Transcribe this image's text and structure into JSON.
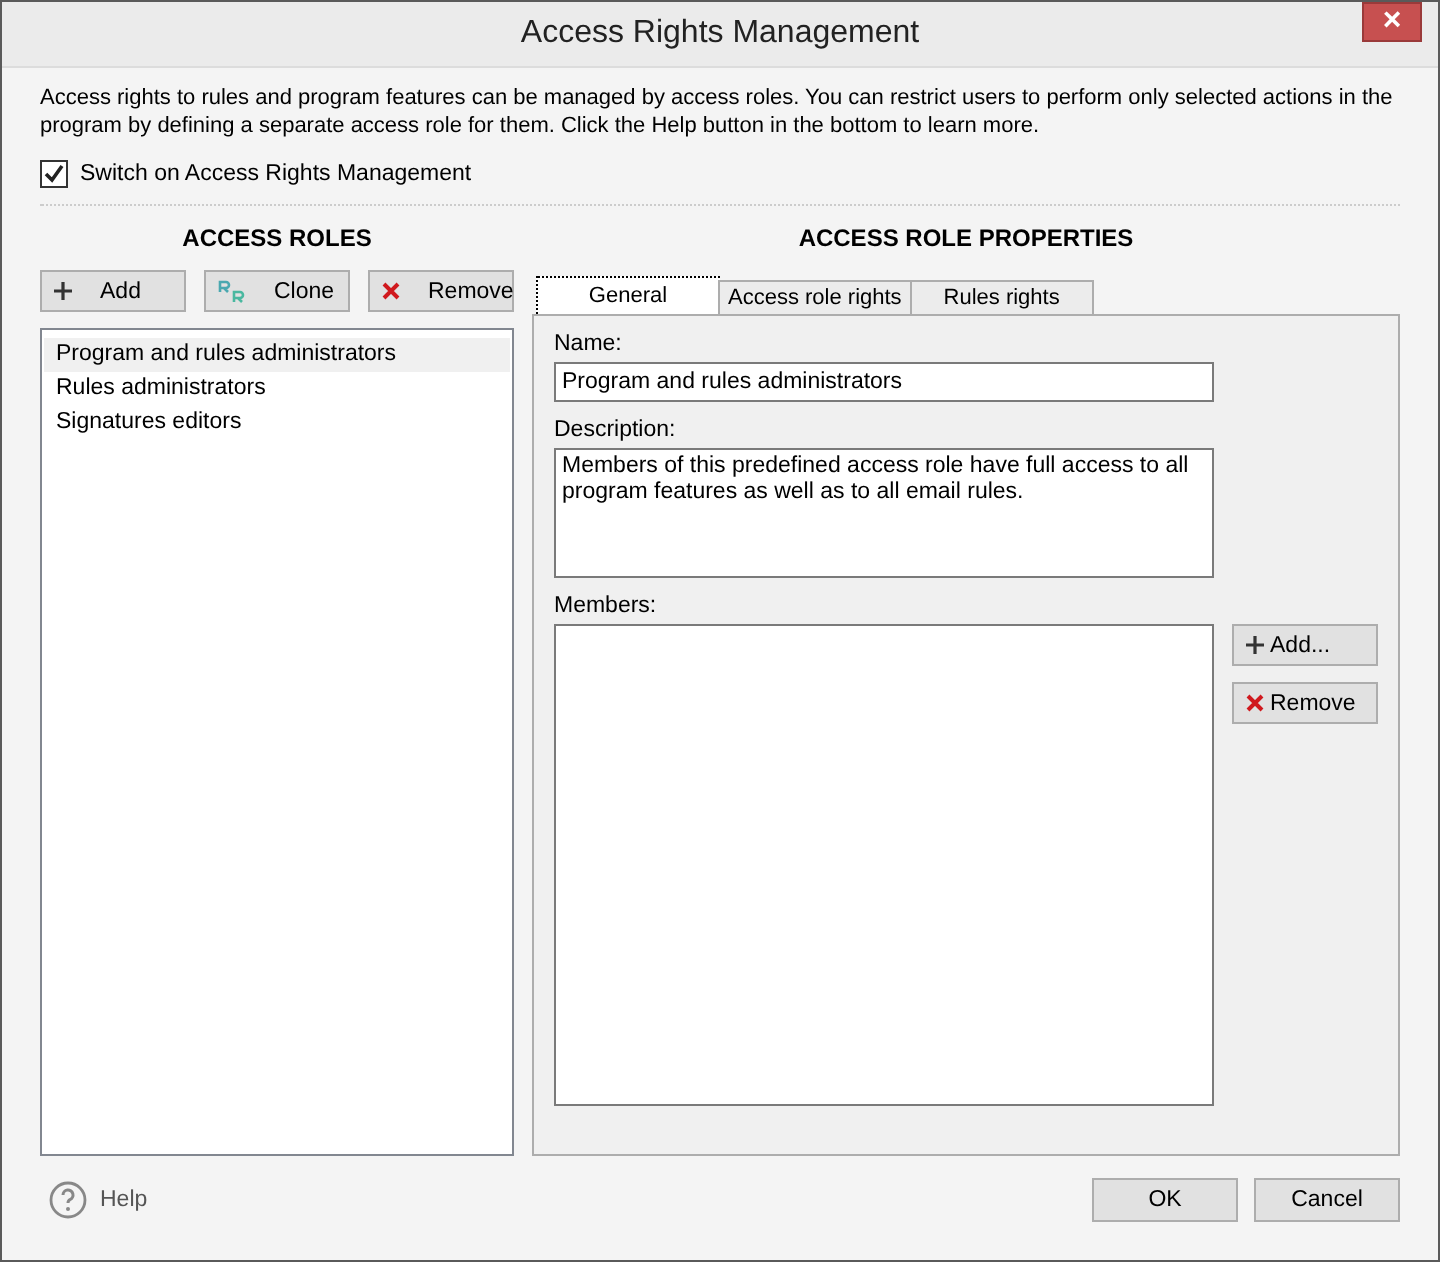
{
  "window": {
    "title": "Access Rights Management",
    "close": "×"
  },
  "intro": "Access rights to rules and program features can be managed by access roles. You can restrict users to perform only selected actions in the program by defining a separate access role for them. Click the Help button in the bottom to learn more.",
  "switch": {
    "label": "Switch on Access Rights Management",
    "checked": true
  },
  "roles": {
    "heading": "ACCESS ROLES",
    "buttons": [
      {
        "kind": "add",
        "label": "Add"
      },
      {
        "kind": "clone",
        "label": "Clone"
      },
      {
        "kind": "remove",
        "label": "Remove"
      }
    ],
    "items": [
      {
        "label": "Program and rules administrators",
        "selected": true
      },
      {
        "label": "Rules administrators",
        "selected": false
      },
      {
        "label": "Signatures editors",
        "selected": false
      }
    ]
  },
  "properties": {
    "heading": "ACCESS ROLE PROPERTIES",
    "tabs": [
      {
        "label": "General",
        "selected": true
      },
      {
        "label": "Access role rights",
        "selected": false
      },
      {
        "label": "Rules rights",
        "selected": false
      }
    ],
    "name_label": "Name:",
    "name_value": "Program and rules administrators",
    "description_label": "Description:",
    "description_value": "Members of this predefined access role have full access to all program features as well as to all email rules.",
    "members_label": "Members:",
    "member_buttons": [
      {
        "kind": "add",
        "label": "Add..."
      },
      {
        "kind": "remove",
        "label": "Remove"
      }
    ]
  },
  "footer": {
    "help": "Help",
    "buttons": [
      "OK",
      "Cancel"
    ]
  }
}
